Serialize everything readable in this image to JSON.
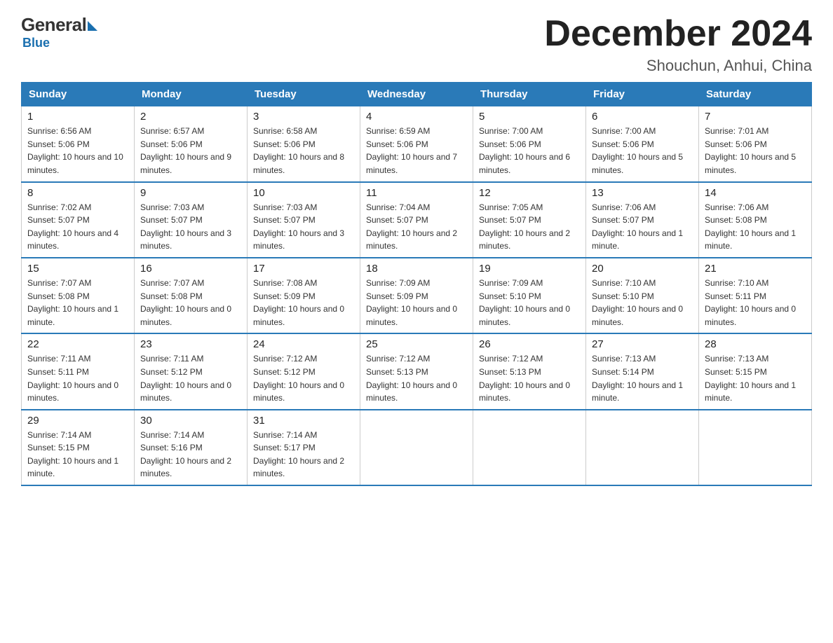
{
  "logo": {
    "general": "General",
    "blue": "Blue"
  },
  "title": "December 2024",
  "location": "Shouchun, Anhui, China",
  "days_of_week": [
    "Sunday",
    "Monday",
    "Tuesday",
    "Wednesday",
    "Thursday",
    "Friday",
    "Saturday"
  ],
  "weeks": [
    [
      {
        "day": "1",
        "sunrise": "6:56 AM",
        "sunset": "5:06 PM",
        "daylight": "10 hours and 10 minutes."
      },
      {
        "day": "2",
        "sunrise": "6:57 AM",
        "sunset": "5:06 PM",
        "daylight": "10 hours and 9 minutes."
      },
      {
        "day": "3",
        "sunrise": "6:58 AM",
        "sunset": "5:06 PM",
        "daylight": "10 hours and 8 minutes."
      },
      {
        "day": "4",
        "sunrise": "6:59 AM",
        "sunset": "5:06 PM",
        "daylight": "10 hours and 7 minutes."
      },
      {
        "day": "5",
        "sunrise": "7:00 AM",
        "sunset": "5:06 PM",
        "daylight": "10 hours and 6 minutes."
      },
      {
        "day": "6",
        "sunrise": "7:00 AM",
        "sunset": "5:06 PM",
        "daylight": "10 hours and 5 minutes."
      },
      {
        "day": "7",
        "sunrise": "7:01 AM",
        "sunset": "5:06 PM",
        "daylight": "10 hours and 5 minutes."
      }
    ],
    [
      {
        "day": "8",
        "sunrise": "7:02 AM",
        "sunset": "5:07 PM",
        "daylight": "10 hours and 4 minutes."
      },
      {
        "day": "9",
        "sunrise": "7:03 AM",
        "sunset": "5:07 PM",
        "daylight": "10 hours and 3 minutes."
      },
      {
        "day": "10",
        "sunrise": "7:03 AM",
        "sunset": "5:07 PM",
        "daylight": "10 hours and 3 minutes."
      },
      {
        "day": "11",
        "sunrise": "7:04 AM",
        "sunset": "5:07 PM",
        "daylight": "10 hours and 2 minutes."
      },
      {
        "day": "12",
        "sunrise": "7:05 AM",
        "sunset": "5:07 PM",
        "daylight": "10 hours and 2 minutes."
      },
      {
        "day": "13",
        "sunrise": "7:06 AM",
        "sunset": "5:07 PM",
        "daylight": "10 hours and 1 minute."
      },
      {
        "day": "14",
        "sunrise": "7:06 AM",
        "sunset": "5:08 PM",
        "daylight": "10 hours and 1 minute."
      }
    ],
    [
      {
        "day": "15",
        "sunrise": "7:07 AM",
        "sunset": "5:08 PM",
        "daylight": "10 hours and 1 minute."
      },
      {
        "day": "16",
        "sunrise": "7:07 AM",
        "sunset": "5:08 PM",
        "daylight": "10 hours and 0 minutes."
      },
      {
        "day": "17",
        "sunrise": "7:08 AM",
        "sunset": "5:09 PM",
        "daylight": "10 hours and 0 minutes."
      },
      {
        "day": "18",
        "sunrise": "7:09 AM",
        "sunset": "5:09 PM",
        "daylight": "10 hours and 0 minutes."
      },
      {
        "day": "19",
        "sunrise": "7:09 AM",
        "sunset": "5:10 PM",
        "daylight": "10 hours and 0 minutes."
      },
      {
        "day": "20",
        "sunrise": "7:10 AM",
        "sunset": "5:10 PM",
        "daylight": "10 hours and 0 minutes."
      },
      {
        "day": "21",
        "sunrise": "7:10 AM",
        "sunset": "5:11 PM",
        "daylight": "10 hours and 0 minutes."
      }
    ],
    [
      {
        "day": "22",
        "sunrise": "7:11 AM",
        "sunset": "5:11 PM",
        "daylight": "10 hours and 0 minutes."
      },
      {
        "day": "23",
        "sunrise": "7:11 AM",
        "sunset": "5:12 PM",
        "daylight": "10 hours and 0 minutes."
      },
      {
        "day": "24",
        "sunrise": "7:12 AM",
        "sunset": "5:12 PM",
        "daylight": "10 hours and 0 minutes."
      },
      {
        "day": "25",
        "sunrise": "7:12 AM",
        "sunset": "5:13 PM",
        "daylight": "10 hours and 0 minutes."
      },
      {
        "day": "26",
        "sunrise": "7:12 AM",
        "sunset": "5:13 PM",
        "daylight": "10 hours and 0 minutes."
      },
      {
        "day": "27",
        "sunrise": "7:13 AM",
        "sunset": "5:14 PM",
        "daylight": "10 hours and 1 minute."
      },
      {
        "day": "28",
        "sunrise": "7:13 AM",
        "sunset": "5:15 PM",
        "daylight": "10 hours and 1 minute."
      }
    ],
    [
      {
        "day": "29",
        "sunrise": "7:14 AM",
        "sunset": "5:15 PM",
        "daylight": "10 hours and 1 minute."
      },
      {
        "day": "30",
        "sunrise": "7:14 AM",
        "sunset": "5:16 PM",
        "daylight": "10 hours and 2 minutes."
      },
      {
        "day": "31",
        "sunrise": "7:14 AM",
        "sunset": "5:17 PM",
        "daylight": "10 hours and 2 minutes."
      },
      null,
      null,
      null,
      null
    ]
  ],
  "labels": {
    "sunrise": "Sunrise:",
    "sunset": "Sunset:",
    "daylight": "Daylight:"
  }
}
